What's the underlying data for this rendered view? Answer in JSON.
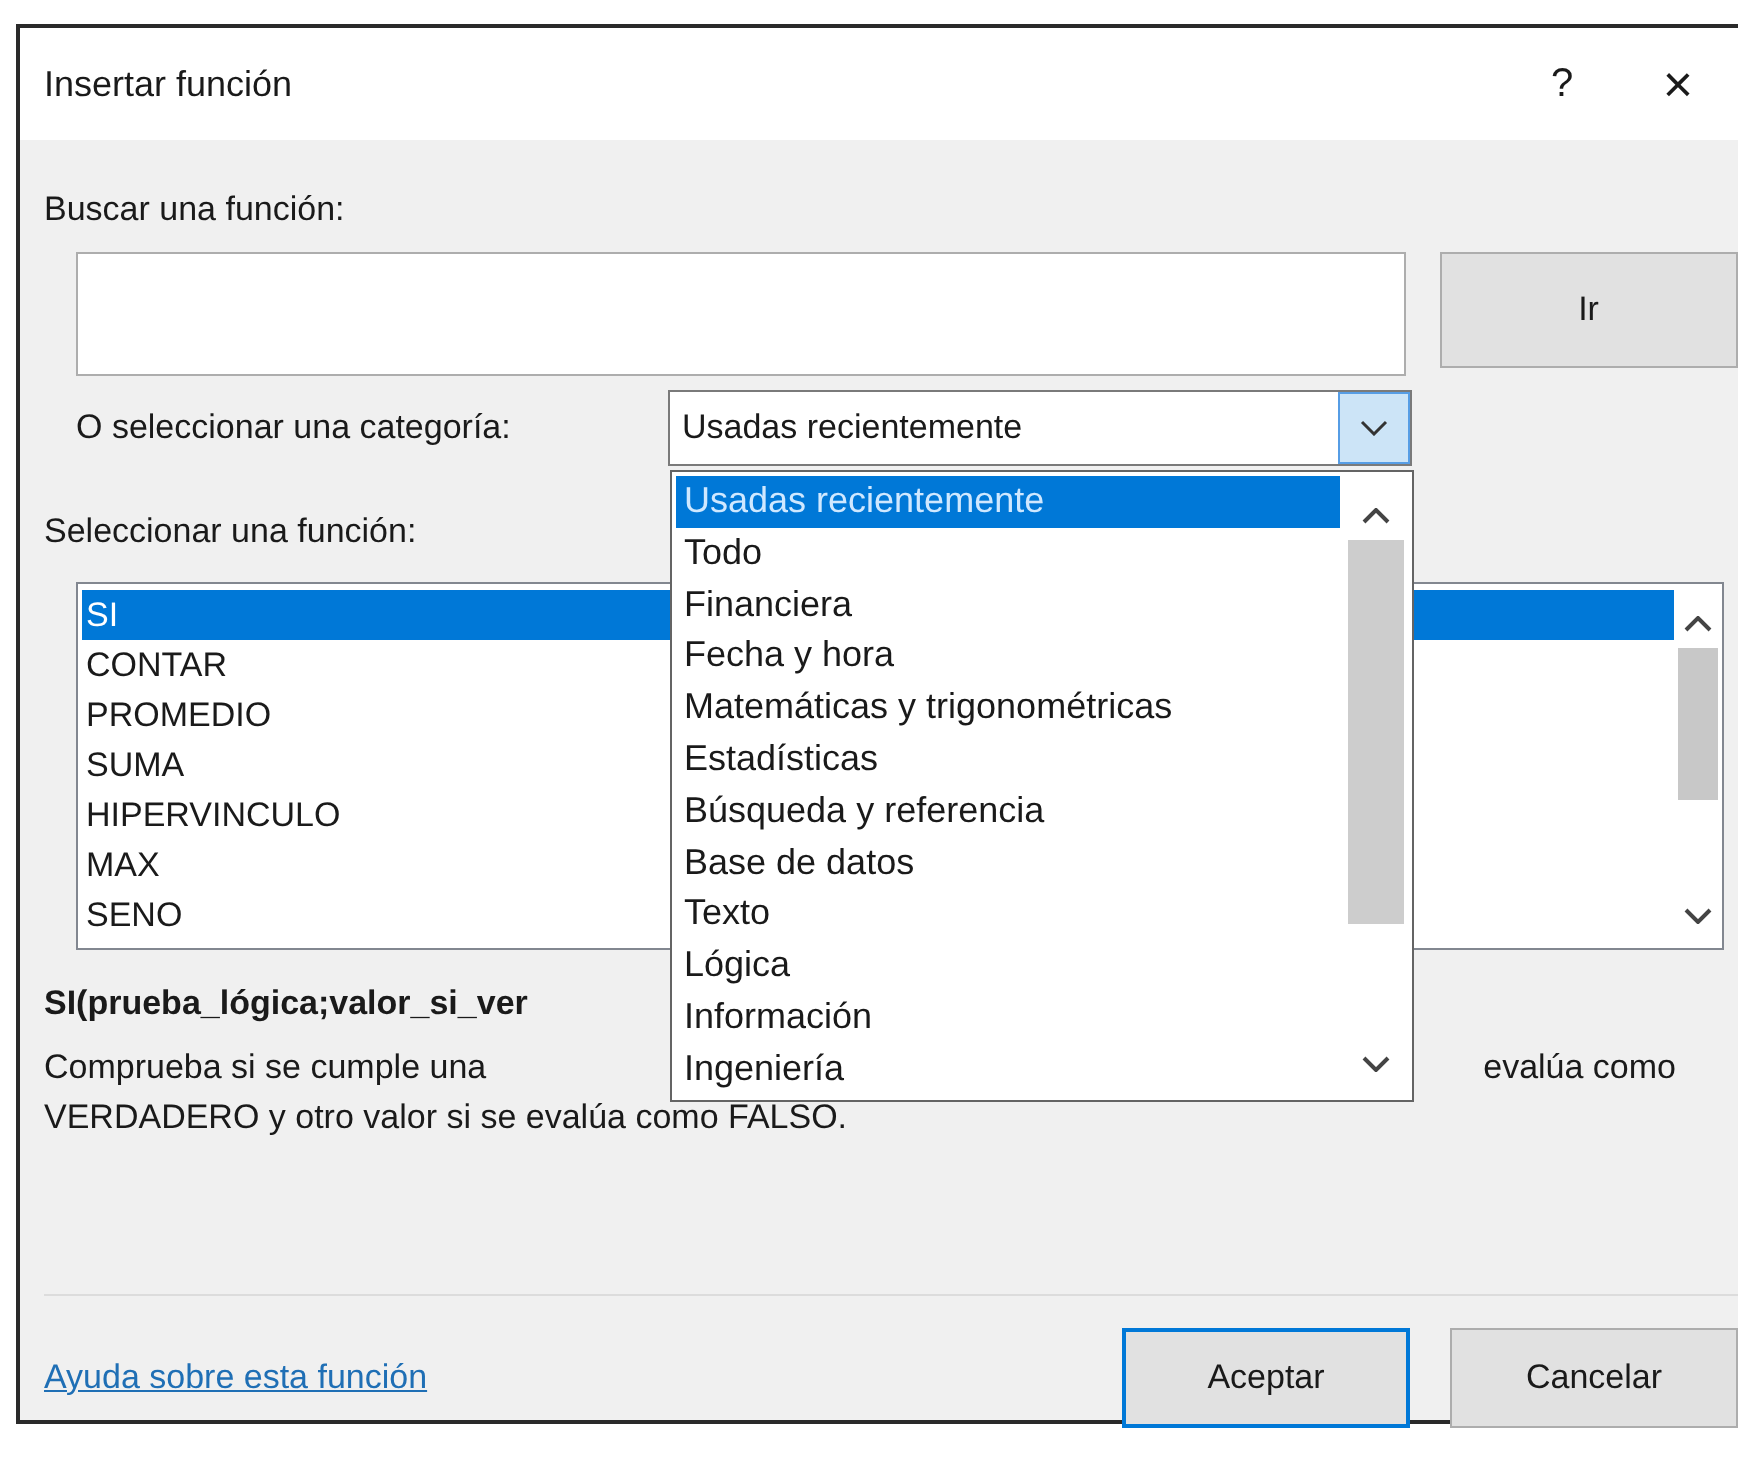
{
  "window": {
    "title": "Insertar función",
    "help_button": "?",
    "close_button": "×"
  },
  "search": {
    "label": "Buscar una función:",
    "go_button": "Ir"
  },
  "category": {
    "label": "O seleccionar una categoría:",
    "value": "Usadas recientemente",
    "expanded": true,
    "options": [
      {
        "label": "Usadas recientemente",
        "selected": true
      },
      {
        "label": "Todo",
        "selected": false
      },
      {
        "label": "Financiera",
        "selected": false
      },
      {
        "label": "Fecha y hora",
        "selected": false
      },
      {
        "label": "Matemáticas y trigonométricas",
        "selected": false
      },
      {
        "label": "Estadísticas",
        "selected": false
      },
      {
        "label": "Búsqueda y referencia",
        "selected": false
      },
      {
        "label": "Base de datos",
        "selected": false
      },
      {
        "label": "Texto",
        "selected": false
      },
      {
        "label": "Lógica",
        "selected": false
      },
      {
        "label": "Información",
        "selected": false
      },
      {
        "label": "Ingeniería",
        "selected": false
      }
    ]
  },
  "functions": {
    "label": "Seleccionar una función:",
    "items": [
      {
        "label": "SI",
        "selected": true
      },
      {
        "label": "CONTAR",
        "selected": false
      },
      {
        "label": "PROMEDIO",
        "selected": false
      },
      {
        "label": "SUMA",
        "selected": false
      },
      {
        "label": "HIPERVINCULO",
        "selected": false
      },
      {
        "label": "MAX",
        "selected": false
      },
      {
        "label": "SENO",
        "selected": false
      }
    ]
  },
  "signature": "SI(prueba_lógica;valor_si_ver",
  "description": {
    "line_1_start": "Comprueba si se cumple una",
    "line_1_end": "evalúa como",
    "line_2": "VERDADERO y otro valor si se evalúa como FALSO."
  },
  "help_link": "Ayuda sobre esta función",
  "buttons": [
    {
      "label": "Aceptar",
      "default": true
    },
    {
      "label": "Cancelar",
      "default": false
    }
  ]
}
